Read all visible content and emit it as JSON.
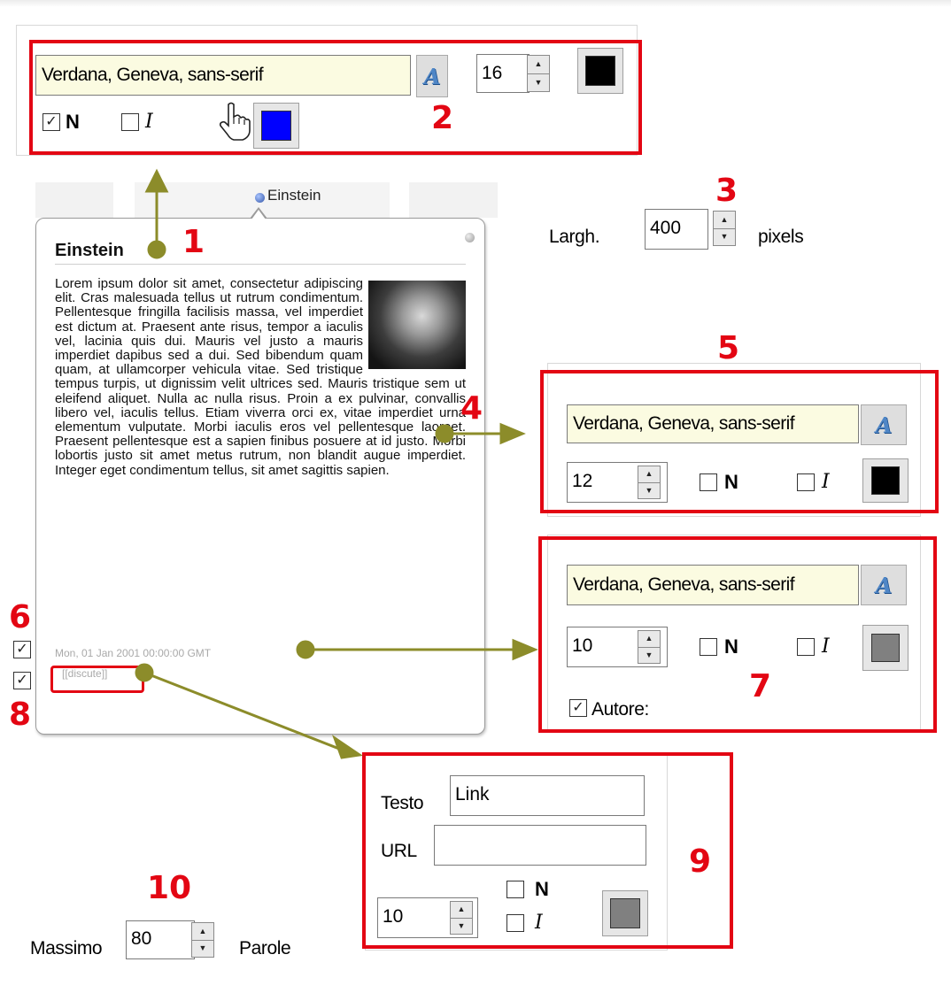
{
  "colors": {
    "annotation_red": "#e30613",
    "arrow_olive": "#8c8c2a",
    "field_bg": "#fbfbe1",
    "title_blue": "#0000ff"
  },
  "annotations": [
    "1",
    "2",
    "3",
    "4",
    "5",
    "6",
    "7",
    "8",
    "9",
    "10"
  ],
  "title_panel": {
    "font_family": "Verdana, Geneva, sans-serif",
    "font_size": "16",
    "bold_label": "N",
    "italic_label": "I",
    "bold_checked": true,
    "italic_checked": false,
    "text_color": "#000000",
    "hover_color": "#0000ff",
    "icons": [
      "font-picker-icon",
      "hand-pointer-icon"
    ]
  },
  "tooltip": {
    "tab_label": "Einstein",
    "title": "Einstein",
    "body": "Lorem ipsum dolor sit amet, consectetur adipiscing elit. Cras malesuada tellus ut rutrum condimentum. Pellentesque fringilla facilisis massa, vel imperdiet est dictum at. Praesent ante risus, tempor a iaculis vel, lacinia quis dui. Mauris vel justo a mauris imperdiet dapibus sed a dui. Sed bibendum quam quam, at ullamcorper vehicula vitae. Sed tristique tempus turpis, ut dignissim velit ultrices sed. Mauris tristique sem ut eleifend aliquet. Nulla ac nulla risus. Proin a ex pulvinar, convallis libero vel, iaculis tellus. Etiam viverra orci ex, vitae imperdiet urna elementum vulputate. Morbi iaculis eros vel pellentesque laoreet. Praesent pellentesque est a sapien finibus posuere at id justo. Morbi lobortis justo sit amet metus rutrum, non blandit augue imperdiet. Integer eget condimentum tellus, sit amet sagittis sapien.",
    "date": "Mon, 01 Jan 2001 00:00:00 GMT",
    "link": "[[discute]]"
  },
  "width_setting": {
    "label": "Largh.",
    "value": "400",
    "unit": "pixels"
  },
  "body_panel": {
    "font_family": "Verdana, Geneva, sans-serif",
    "font_size": "12",
    "bold_label": "N",
    "italic_label": "I",
    "bold_checked": false,
    "italic_checked": false,
    "text_color": "#000000"
  },
  "date_panel": {
    "font_family": "Verdana, Geneva, sans-serif",
    "font_size": "10",
    "bold_label": "N",
    "italic_label": "I",
    "bold_checked": false,
    "italic_checked": false,
    "text_color": "#808080",
    "author_label": "Autore:",
    "author_checked": true
  },
  "left_checks": {
    "show_date": true,
    "show_link": true
  },
  "link_panel": {
    "text_label": "Testo",
    "text_value": "Link",
    "url_label": "URL",
    "url_value": "",
    "font_size": "10",
    "bold_label": "N",
    "italic_label": "I",
    "bold_checked": false,
    "italic_checked": false,
    "text_color": "#808080"
  },
  "max_words": {
    "label": "Massimo",
    "value": "80",
    "unit": "Parole"
  }
}
